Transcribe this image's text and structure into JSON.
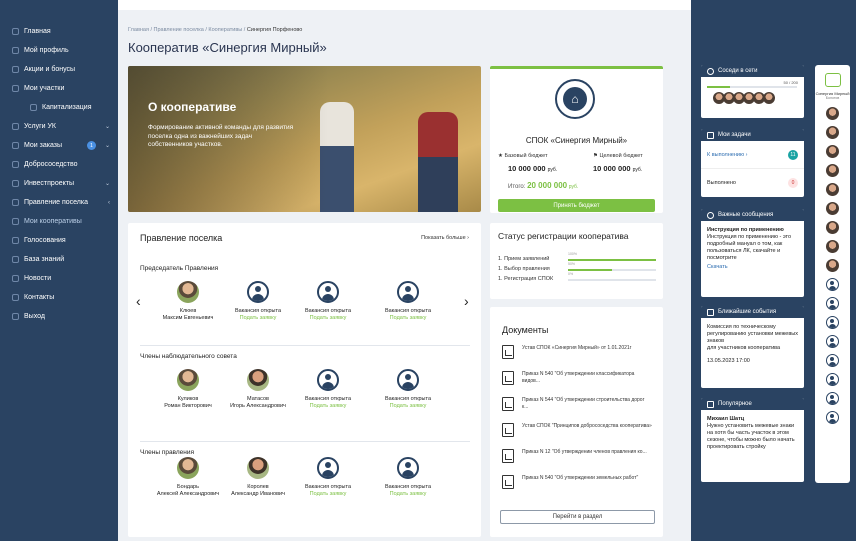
{
  "sidebar": {
    "items": [
      {
        "label": "Главная"
      },
      {
        "label": "Мой профиль"
      },
      {
        "label": "Акции и бонусы"
      },
      {
        "label": "Мои участки"
      },
      {
        "label": "Капитализация",
        "sub": true
      },
      {
        "label": "Услуги УК",
        "chev": "⌄"
      },
      {
        "label": "Мои заказы",
        "badge": "1",
        "chev": "⌄"
      },
      {
        "label": "Добрососедство"
      },
      {
        "label": "Инвестпроекты",
        "chev": "⌄"
      },
      {
        "label": "Правление поселка",
        "chev": "‹"
      },
      {
        "label": "Мои кооперативы",
        "active": true
      },
      {
        "label": "Голосования"
      },
      {
        "label": "База знаний"
      },
      {
        "label": "Новости"
      },
      {
        "label": "Контакты"
      },
      {
        "label": "Выход"
      }
    ]
  },
  "breadcrumbs": {
    "b1": "Главная",
    "b2": "Правление поселка",
    "b3": "Кооперативы",
    "b4": "Синергия Порфеново",
    "sep": " / "
  },
  "page_title": "Кооператив «Синергия Мирный»",
  "hero": {
    "title": "О кооперативе",
    "text": "Формирование активной команды для развития поселка одна из важнейших задач собственников участков."
  },
  "budget": {
    "name": "СПОК «Синергия Мирный»",
    "base_label": "Базовый бюджет",
    "target_label": "Целевой бюджет",
    "base_value": "10 000 000",
    "target_value": "10 000 000",
    "currency": "руб.",
    "total_label": "Итого:",
    "total_value": "20 000 000",
    "button": "Принять бюджет"
  },
  "board": {
    "title": "Правление поселка",
    "more": "Показать больше ›",
    "chair_title": "Председатель Правления",
    "chair": [
      {
        "name": "Клюев\nМаксим Евгеньевич",
        "photo": "photo"
      },
      {
        "name": "Вакансия открыта",
        "link": "Подать заявку"
      },
      {
        "name": "Вакансия открыта",
        "link": "Подать заявку"
      },
      {
        "name": "Вакансия открыта",
        "link": "Подать заявку"
      }
    ],
    "council_title": "Члены наблюдательного совета",
    "council": [
      {
        "name": "Куликов\nРоман Викторович",
        "photo": "photo"
      },
      {
        "name": "Матасов\nИгорь Александрович",
        "photo": "photo2"
      },
      {
        "name": "Вакансия открыта",
        "link": "Подать заявку"
      },
      {
        "name": "Вакансия открыта",
        "link": "Подать заявку"
      }
    ],
    "members_title": "Члены правления",
    "members": [
      {
        "name": "Бондарь\nАлексей Александрович",
        "photo": "photo"
      },
      {
        "name": "Королев\nАлександр Иванович",
        "photo": "photo2"
      },
      {
        "name": "Вакансия открыта",
        "link": "Подать заявку"
      },
      {
        "name": "Вакансия открыта",
        "link": "Подать заявку"
      }
    ]
  },
  "status": {
    "title": "Статус регистрации кооператива",
    "rows": [
      {
        "label": "1. Прием заявлений",
        "pct": "100%",
        "value": 1.0
      },
      {
        "label": "1. Выбор правления",
        "pct": "50%",
        "value": 0.5
      },
      {
        "label": "1. Регистрация СПОК",
        "pct": "0%",
        "value": 0.0
      }
    ]
  },
  "docs": {
    "title": "Документы",
    "items": [
      "Устав СПОК «Синергия Мирный» от 1.01.2021г",
      "Приказ N 540 \"Об утверждении классификатора видов...",
      "Приказ N 544 \"Об утверждении строительства дорог к...",
      "Устав СПОК \"Принципов добрососедства кооператива»",
      "Приказ N 12 \"Об утверждении членов правления ко...",
      "Приказ N 540 \"Об утверждении земельных работ\""
    ],
    "button": "Перейти в раздел"
  },
  "right": {
    "neighbors": {
      "title": "Соседи в сети",
      "count": "50 / 200"
    },
    "tasks": {
      "title": "Мои задачи",
      "todo": "К выполнению ›",
      "todo_count": "11",
      "done": "Выполнено",
      "done_count": "0"
    },
    "important": {
      "title": "Важные сообщения",
      "heading": "Инструкция по применению",
      "text": "Инструкция по применению - это подробный мануал о том, как пользоваться ЛК, скачайте и посмотрите",
      "link": "Скачать"
    },
    "events": {
      "title": "Ближайшие события",
      "text": "Комиссия по техническому регулированию установки межевых знаков\nдля участников кооператива",
      "date": "13.05.2023   17:00"
    },
    "popular": {
      "title": "Популярное",
      "author": "Михаил Шатц",
      "text": "Нужно установить межевые знаки на хотя бы часть участок в этом сезоне, чтобы можно было начать проектировать стройку"
    },
    "rail": {
      "name": "Синергия Мирный",
      "sub": "Болотов"
    }
  }
}
